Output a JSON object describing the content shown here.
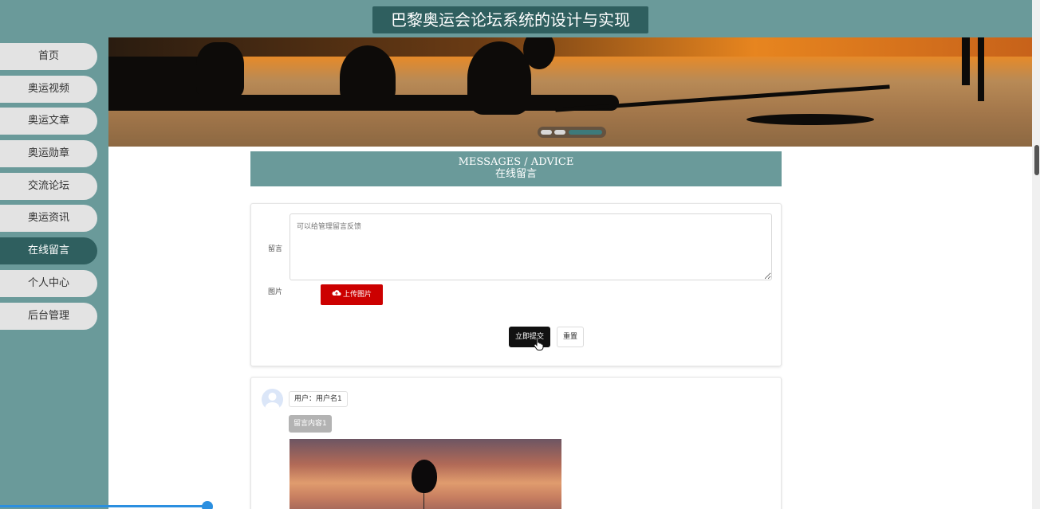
{
  "header": {
    "title": "巴黎奥运会论坛系统的设计与实现"
  },
  "sidebar": {
    "items": [
      {
        "label": "首页",
        "active": false
      },
      {
        "label": "奥运视频",
        "active": false
      },
      {
        "label": "奥运文章",
        "active": false
      },
      {
        "label": "奥运勋章",
        "active": false
      },
      {
        "label": "交流论坛",
        "active": false
      },
      {
        "label": "奥运资讯",
        "active": false
      },
      {
        "label": "在线留言",
        "active": true
      },
      {
        "label": "个人中心",
        "active": false
      },
      {
        "label": "后台管理",
        "active": false
      }
    ]
  },
  "banner": {
    "slide_count": 3,
    "active_slide": 3
  },
  "section": {
    "title_en": "MESSAGES / ADVICE",
    "title_cn": "在线留言"
  },
  "form": {
    "message_label": "留言",
    "message_placeholder": "可以给管理留言反馈",
    "image_label": "图片",
    "upload_label": "上传图片",
    "submit_label": "立即提交",
    "reset_label": "重置"
  },
  "messages": [
    {
      "user": "用户：用户名1",
      "content": "留言内容1"
    }
  ],
  "colors": {
    "primary": "#6a9a9a",
    "primary_dark": "#2f5f5f",
    "danger": "#cc0000"
  }
}
